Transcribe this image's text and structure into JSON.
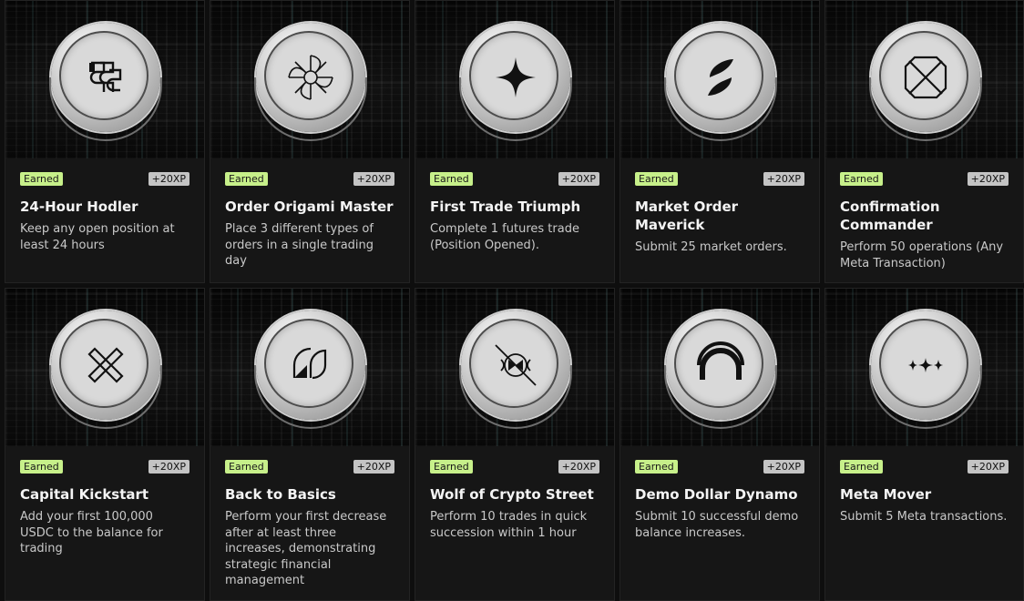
{
  "achievements": [
    {
      "status": "Earned",
      "xp": "+20XP",
      "title": "24-Hour Hodler",
      "description": "Keep any open position at least 24 hours",
      "icon": "stacked-s-icon"
    },
    {
      "status": "Earned",
      "xp": "+20XP",
      "title": "Order Origami Master",
      "description": "Place 3 different types of orders in a single trading day",
      "icon": "origami-flower-icon"
    },
    {
      "status": "Earned",
      "xp": "+20XP",
      "title": "First Trade Triumph",
      "description": "Complete 1 futures trade (Position Opened).",
      "icon": "four-point-star-icon"
    },
    {
      "status": "Earned",
      "xp": "+20XP",
      "title": "Market Order Maverick",
      "description": "Submit 25 market orders.",
      "icon": "twin-leaf-icon"
    },
    {
      "status": "Earned",
      "xp": "+20XP",
      "title": "Confirmation Commander",
      "description": "Perform 50 operations (Any Meta Transaction)",
      "icon": "octagon-cross-icon"
    },
    {
      "status": "Earned",
      "xp": "+20XP",
      "title": "Capital Kickstart",
      "description": "Add your first 100,000 USDC to the balance for trading",
      "icon": "crossed-bars-icon"
    },
    {
      "status": "Earned",
      "xp": "+20XP",
      "title": "Back to Basics",
      "description": "Perform your first decrease after at least three increases, demonstrating strategic financial management",
      "icon": "quarter-arcs-icon"
    },
    {
      "status": "Earned",
      "xp": "+20XP",
      "title": "Wolf of Crypto Street",
      "description": "Perform 10 trades in quick succession within 1 hour",
      "icon": "bowtie-circle-icon"
    },
    {
      "status": "Earned",
      "xp": "+20XP",
      "title": "Demo Dollar Dynamo",
      "description": "Submit 10 successful demo balance increases.",
      "icon": "double-arch-icon"
    },
    {
      "status": "Earned",
      "xp": "+20XP",
      "title": "Meta Mover",
      "description": "Submit 5 Meta transactions.",
      "icon": "triple-sparkle-icon"
    }
  ],
  "colors": {
    "earned_badge": "#c7f08a",
    "xp_badge": "#c4c4c4",
    "card_bg": "#161616",
    "title": "#f4f4f4",
    "description": "#c9c9c9"
  }
}
